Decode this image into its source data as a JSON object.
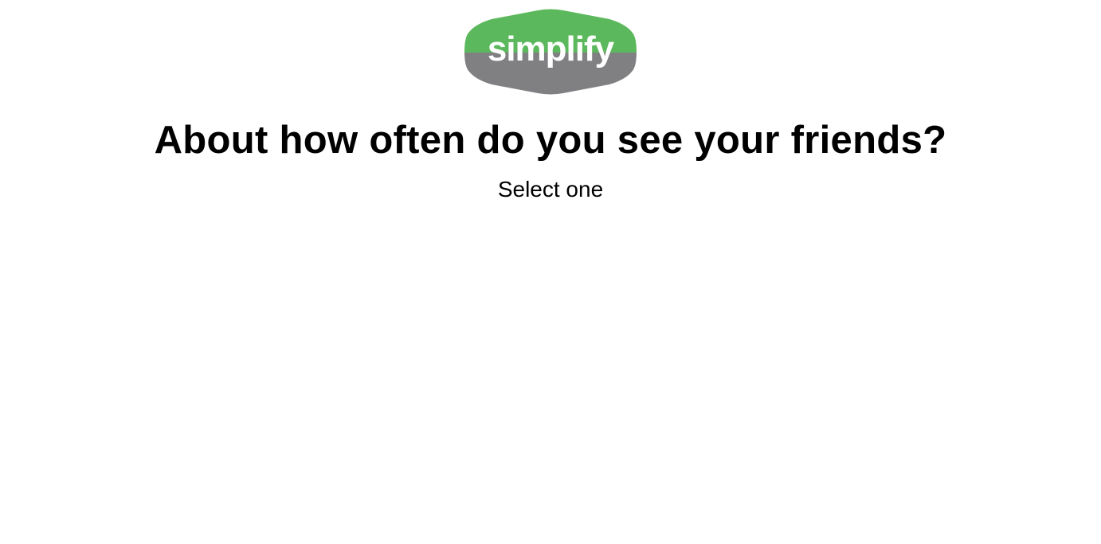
{
  "brand": {
    "logo_text": "simplify",
    "top_color": "#5cb85c",
    "bottom_color": "#808083",
    "text_color": "#ffffff"
  },
  "survey": {
    "question": "About how often do you see your friends?",
    "instruction": "Select one"
  }
}
